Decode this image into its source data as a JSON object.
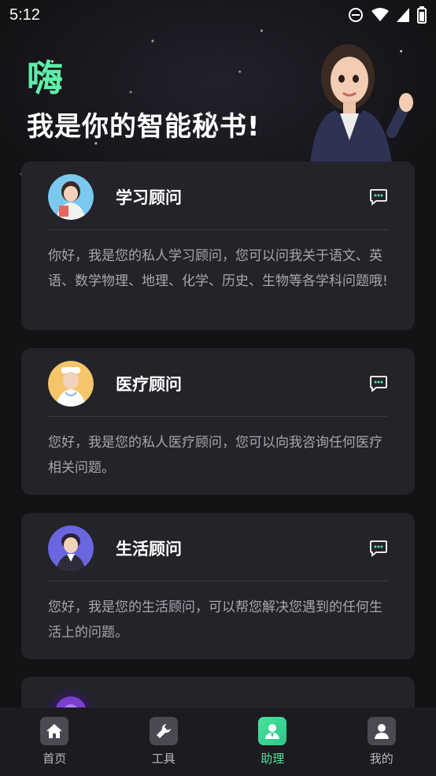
{
  "status_bar": {
    "time": "5:12",
    "icons": [
      "do-not-disturb-icon",
      "wifi-icon",
      "signal-icon",
      "battery-icon"
    ]
  },
  "header": {
    "hi": "嗨",
    "subtitle": "我是你的智能秘书!"
  },
  "cards": [
    {
      "title": "学习顾问",
      "desc": "你好，我是您的私人学习顾问，您可以问我关于语文、英语、数学物理、地理、化学、历史、生物等各学科问题哦!",
      "icon": "chat-bubble-icon"
    },
    {
      "title": "医疗顾问",
      "desc": "您好，我是您的私人医疗顾问，您可以向我咨询任何医疗相关问题。",
      "icon": "chat-bubble-icon"
    },
    {
      "title": "生活顾问",
      "desc": "您好，我是您的生活顾问，可以帮您解决您遇到的任何生活上的问题。",
      "icon": "chat-bubble-icon"
    }
  ],
  "bottom_nav": {
    "items": [
      {
        "label": "首页",
        "icon": "home-icon"
      },
      {
        "label": "工具",
        "icon": "wrench-icon"
      },
      {
        "label": "助理",
        "icon": "assistant-icon",
        "active": true
      },
      {
        "label": "我的",
        "icon": "profile-icon"
      }
    ]
  },
  "colors": {
    "accent": "#4fe3a0",
    "card_bg": "#23232a",
    "page_bg": "#131316"
  }
}
